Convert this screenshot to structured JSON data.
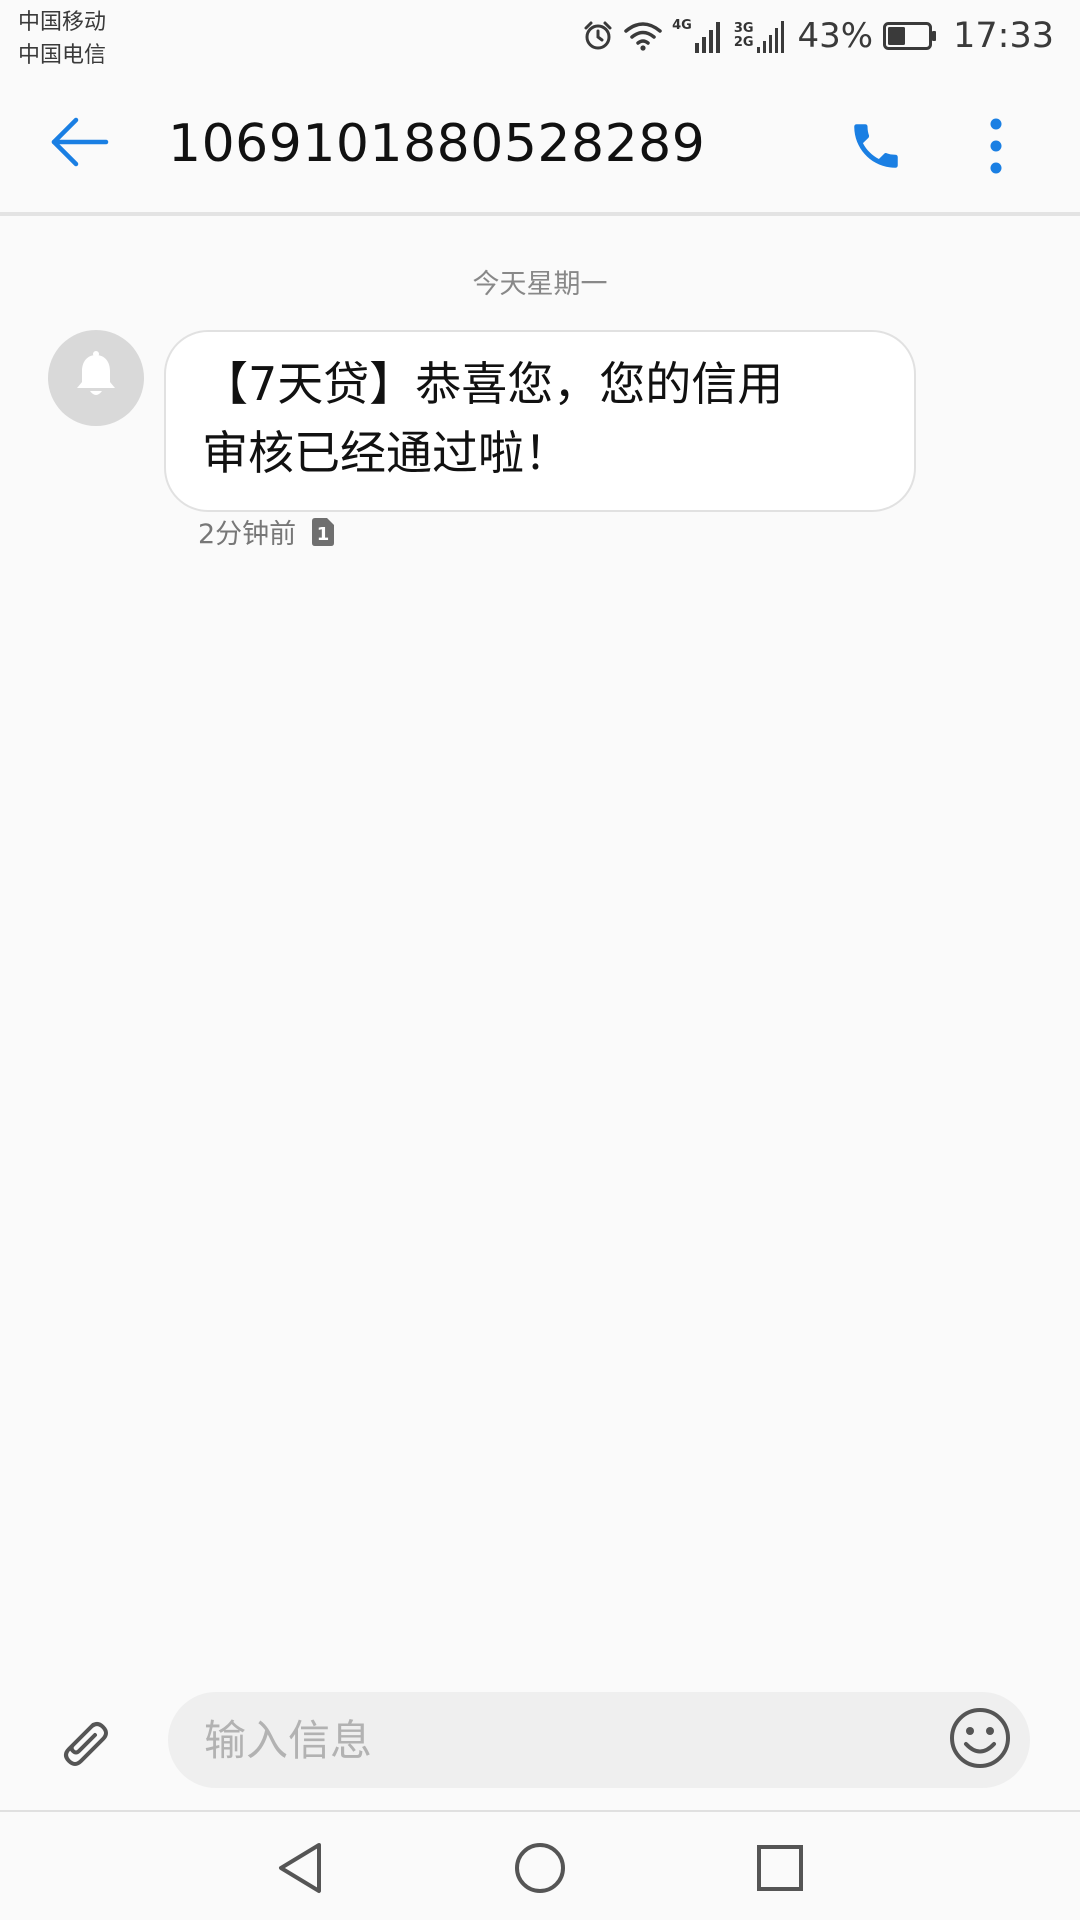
{
  "status_bar": {
    "carrier_1": "中国移动",
    "carrier_2": "中国电信",
    "net_1": "4G",
    "net_2_top": "3G",
    "net_2_bottom": "2G",
    "battery_percent": "43%",
    "battery_level": 0.43,
    "time": "17:33"
  },
  "header": {
    "title": "1069101880528289",
    "icons": {
      "back": "back-arrow-icon",
      "call": "phone-icon",
      "menu": "more-vertical-icon"
    }
  },
  "conversation": {
    "date_divider": "今天星期一",
    "messages": [
      {
        "line_1": "【7天贷】恭喜您，您的信用",
        "line_2": "审核已经通过啦！",
        "time": "2分钟前",
        "sim_badge": "1",
        "avatar_icon": "bell-icon"
      }
    ]
  },
  "composer": {
    "placeholder": "输入信息",
    "value": "",
    "icons": {
      "attach": "paperclip-icon",
      "emoji": "emoji-icon"
    }
  },
  "navigation": {
    "icons": [
      "back-triangle-icon",
      "home-circle-icon",
      "recents-square-icon"
    ]
  },
  "colors": {
    "accent": "#1a7fe3",
    "background": "#fafafa",
    "bubble": "#ffffff",
    "composer": "#efefef"
  }
}
